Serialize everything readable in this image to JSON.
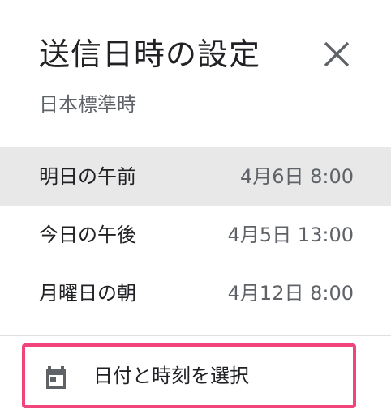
{
  "dialog": {
    "title": "送信日時の設定",
    "timezone": "日本標準時",
    "close_icon": "close-icon"
  },
  "options": [
    {
      "label": "明日の午前",
      "time": "4月6日 8:00",
      "selected": true
    },
    {
      "label": "今日の午後",
      "time": "4月5日 13:00",
      "selected": false
    },
    {
      "label": "月曜日の朝",
      "time": "4月12日 8:00",
      "selected": false
    }
  ],
  "pick": {
    "label": "日付と時刻を選択",
    "icon": "calendar-icon",
    "highlight_color": "#f0457b"
  },
  "colors": {
    "selected_background": "#e8e8e8",
    "secondary_text": "#5f6368",
    "primary_text": "#202124"
  }
}
